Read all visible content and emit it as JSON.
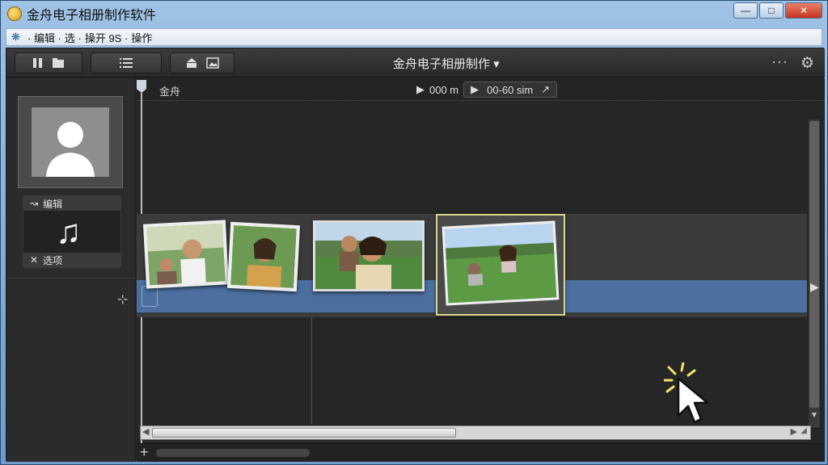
{
  "window": {
    "title": "金舟电子相册制作软件",
    "controls": {
      "minimize": "—",
      "maximize": "□",
      "close": "✕"
    }
  },
  "menubar": {
    "items": [
      "· 编辑 ·",
      "选 ·",
      "操开 9S ·",
      "操作"
    ]
  },
  "toolbar": {
    "app_title": "金舟电子相册制作 ▾",
    "more": "···"
  },
  "sidebar": {
    "audio": {
      "top_label": "编辑",
      "bottom_label": "选项"
    }
  },
  "timeline": {
    "ruler_label": "金舟",
    "position": "000 m",
    "duration": "00-60 sim"
  },
  "colors": {
    "track_blue": "#4c6fa0",
    "selection": "#d9d98a"
  }
}
